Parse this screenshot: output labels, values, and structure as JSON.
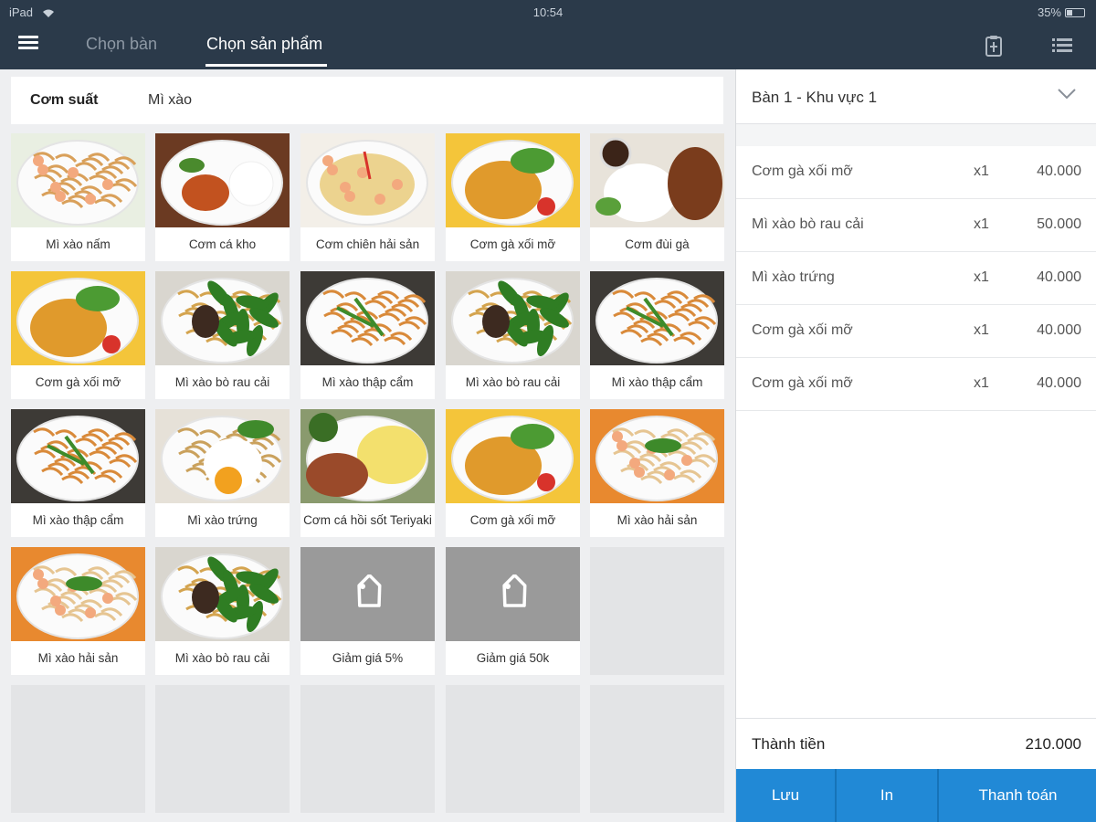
{
  "status_bar": {
    "device": "iPad",
    "time": "10:54",
    "battery": "35%",
    "battery_level": 0.35
  },
  "nav": {
    "tabs": [
      {
        "label": "Chọn bàn",
        "active": false
      },
      {
        "label": "Chọn sản phẩm",
        "active": true
      }
    ]
  },
  "categories": [
    {
      "label": "Cơm suất",
      "selected": true
    },
    {
      "label": "Mì xào",
      "selected": false
    }
  ],
  "products": [
    {
      "label": "Mì xào nấm",
      "image": "fried-noodles-mushroom"
    },
    {
      "label": "Cơm cá kho",
      "image": "braised-fish-rice"
    },
    {
      "label": "Cơm chiên hải sản",
      "image": "seafood-fried-rice"
    },
    {
      "label": "Cơm gà xối mỡ",
      "image": "crispy-chicken-rice"
    },
    {
      "label": "Cơm đùi gà",
      "image": "chicken-leg-rice"
    },
    {
      "label": "Cơm gà xối mỡ",
      "image": "crispy-chicken-rice"
    },
    {
      "label": "Mì xào bò rau cải",
      "image": "beef-noodles-greens"
    },
    {
      "label": "Mì xào thập cẩm",
      "image": "mixed-fried-noodles"
    },
    {
      "label": "Mì xào bò rau cải",
      "image": "beef-noodles-greens"
    },
    {
      "label": "Mì xào thập cẩm",
      "image": "mixed-fried-noodles"
    },
    {
      "label": "Mì xào thập cẩm",
      "image": "mixed-fried-noodles"
    },
    {
      "label": "Mì xào trứng",
      "image": "egg-noodles"
    },
    {
      "label": "Cơm cá hồi sốt Teriyaki",
      "image": "salmon-teriyaki-rice"
    },
    {
      "label": "Cơm gà xối mỡ",
      "image": "crispy-chicken-rice"
    },
    {
      "label": "Mì xào hải sản",
      "image": "seafood-noodles"
    },
    {
      "label": "Mì xào hải sản",
      "image": "seafood-noodles"
    },
    {
      "label": "Mì xào bò rau cải",
      "image": "beef-noodles-greens"
    },
    {
      "label": "Giảm giá 5%",
      "image": "tag-icon"
    },
    {
      "label": "Giảm giá 50k",
      "image": "tag-icon"
    }
  ],
  "order": {
    "table_label": "Bàn 1 - Khu vực 1",
    "items": [
      {
        "name": "Cơm gà xối mỡ",
        "qty": "x1",
        "price": "40.000"
      },
      {
        "name": "Mì xào bò rau cải",
        "qty": "x1",
        "price": "50.000"
      },
      {
        "name": "Mì xào trứng",
        "qty": "x1",
        "price": "40.000"
      },
      {
        "name": "Cơm gà xối mỡ",
        "qty": "x1",
        "price": "40.000"
      },
      {
        "name": "Cơm gà xối mỡ",
        "qty": "x1",
        "price": "40.000"
      }
    ],
    "total_label": "Thành tiền",
    "total_value": "210.000"
  },
  "actions": {
    "save": "Lưu",
    "print": "In",
    "pay": "Thanh toán"
  },
  "colors": {
    "nav_bg": "#2b3a4a",
    "accent": "#2189d6",
    "tile_placeholder": "#9a9a9a"
  }
}
